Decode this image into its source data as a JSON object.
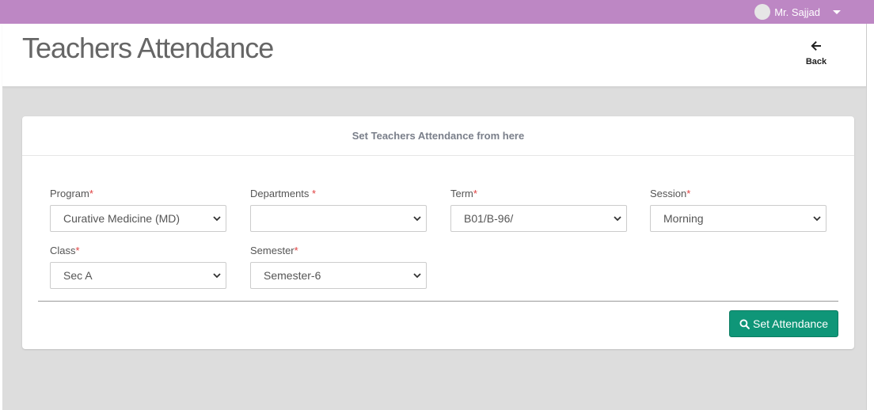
{
  "topbar": {
    "user_name": "Mr. Sajjad",
    "accent_color": "#bd87c4"
  },
  "header": {
    "title": "Teachers Attendance",
    "back_label": "Back"
  },
  "card": {
    "heading": "Set Teachers Attendance from here",
    "fields": {
      "program": {
        "label": "Program",
        "required_mark": "*",
        "value": "Curative Medicine (MD)"
      },
      "departments": {
        "label": "Departments ",
        "required_mark": "*",
        "value": ""
      },
      "term": {
        "label": "Term",
        "required_mark": "*",
        "value": "B01/B-96/"
      },
      "session": {
        "label": "Session",
        "required_mark": "*",
        "value": "Morning"
      },
      "class": {
        "label": "Class",
        "required_mark": "*",
        "value": "Sec A"
      },
      "semester": {
        "label": "Semester",
        "required_mark": "*",
        "value": "Semester-6"
      }
    },
    "submit_label": "Set Attendance",
    "submit_color": "#0f9678"
  }
}
